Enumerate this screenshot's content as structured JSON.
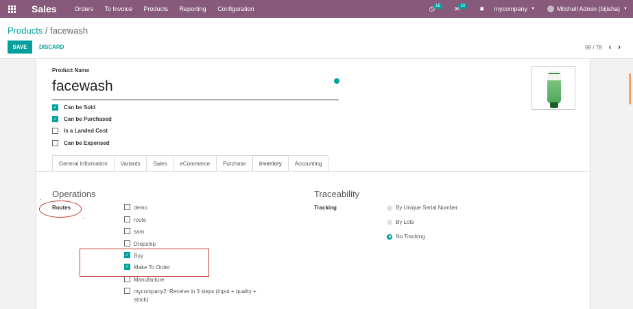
{
  "navbar": {
    "brand": "Sales",
    "menu": [
      "Orders",
      "To Invoice",
      "Products",
      "Reporting",
      "Configuration"
    ],
    "activity_count": "16",
    "messages_count": "10",
    "company": "mycompany",
    "user": "Mitchell Admin (bijisha)"
  },
  "breadcrumb": {
    "parent": "Products",
    "separator": " / ",
    "current": "facewash"
  },
  "actions": {
    "save": "SAVE",
    "discard": "DISCARD"
  },
  "pager": {
    "text": "69 / 78"
  },
  "form": {
    "name_label": "Product Name",
    "name": "facewash",
    "checks": [
      {
        "label": "Can be Sold",
        "checked": true
      },
      {
        "label": "Can be Purchased",
        "checked": true
      },
      {
        "label": "Is a Landed Cost",
        "checked": false
      },
      {
        "label": "Can be Expensed",
        "checked": false
      }
    ],
    "tabs": [
      "General Information",
      "Variants",
      "Sales",
      "eCommerce",
      "Purchase",
      "Inventory",
      "Accounting"
    ],
    "active_tab": "Inventory"
  },
  "operations": {
    "title": "Operations",
    "routes_label": "Routes",
    "routes": [
      {
        "label": "demo",
        "checked": false
      },
      {
        "label": "route",
        "checked": false
      },
      {
        "label": "sam",
        "checked": false
      },
      {
        "label": "Dropship",
        "checked": false
      },
      {
        "label": "Buy",
        "checked": true
      },
      {
        "label": "Make To Order",
        "checked": true
      },
      {
        "label": "Manufacture",
        "checked": false
      },
      {
        "label": "mycompany2: Receive in 3 steps (input + quality +",
        "label_cont": "stock)",
        "checked": false
      }
    ]
  },
  "traceability": {
    "title": "Traceability",
    "tracking_label": "Tracking",
    "options": [
      {
        "label": "By Unique Serial Number",
        "selected": false
      },
      {
        "label": "By Lots",
        "selected": false
      },
      {
        "label": "No Tracking",
        "selected": true
      }
    ]
  },
  "colors": {
    "navbar": "#875A7B",
    "accent": "#00A09D",
    "annotation": "#c0392b"
  }
}
